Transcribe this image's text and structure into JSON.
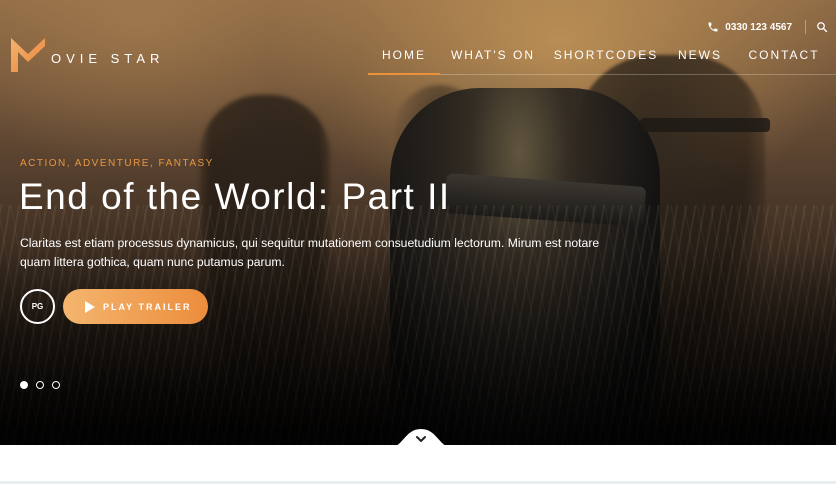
{
  "brand": {
    "logo_text": "OVIE STAR",
    "accent_color": "#e8923a"
  },
  "contact": {
    "phone": "0330 123 4567"
  },
  "nav": {
    "items": [
      {
        "label": "HOME",
        "active": true
      },
      {
        "label": "WHAT'S ON",
        "active": false
      },
      {
        "label": "SHORTCODES",
        "active": false
      },
      {
        "label": "NEWS",
        "active": false
      },
      {
        "label": "CONTACT",
        "active": false
      }
    ]
  },
  "hero": {
    "genres": "ACTION, ADVENTURE, FANTASY",
    "title": "End of the World: Part II",
    "description": "Claritas est etiam processus dynamicus, qui sequitur mutationem consuetudium lectorum. Mirum est notare quam littera gothica, quam nunc putamus parum.",
    "rating": "PG",
    "play_button_label": "PLAY TRAILER",
    "slides": [
      {
        "active": true
      },
      {
        "active": false
      },
      {
        "active": false
      }
    ]
  },
  "icons": {
    "logo": "movie-star-logo-icon",
    "phone": "phone-icon",
    "search": "search-icon",
    "play": "play-icon",
    "scroll": "chevron-down-icon"
  }
}
